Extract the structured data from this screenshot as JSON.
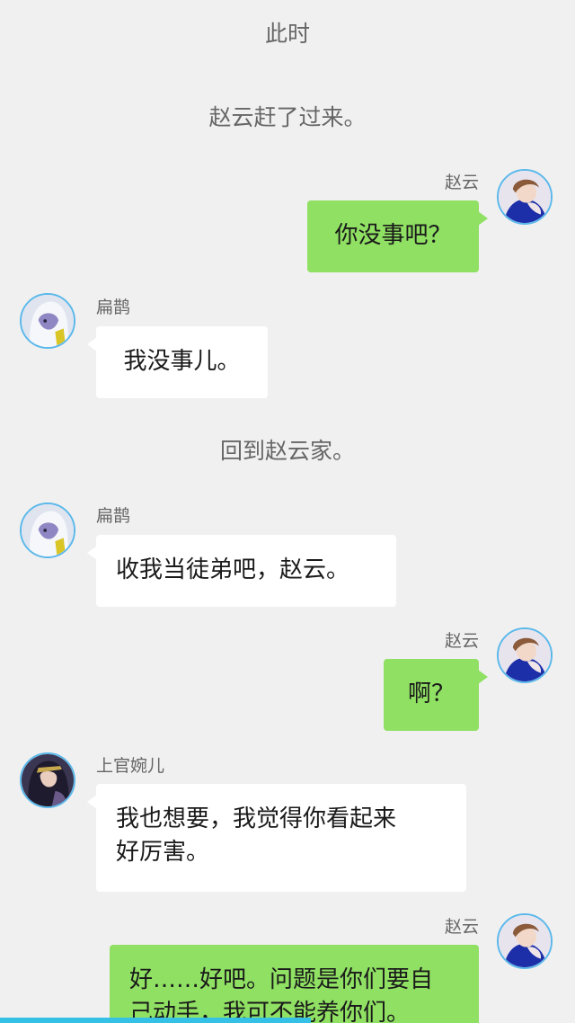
{
  "narration": [
    "此时",
    "赵云赶了过来。",
    "回到赵云家。"
  ],
  "characters": {
    "zhaoyun": {
      "name": "赵云",
      "icon": "zhaoyun-avatar-icon",
      "ring_color": "#5bb8ea"
    },
    "bianque": {
      "name": "扁鹊",
      "icon": "bianque-avatar-icon",
      "ring_color": "#5bb8ea"
    },
    "shangguan": {
      "name": "上官婉儿",
      "icon": "shangguan-wan-er-avatar-icon",
      "ring_color": "#5bb8ea"
    }
  },
  "messages": [
    {
      "speaker": "赵云",
      "text": "你没事吧？",
      "side": "right"
    },
    {
      "speaker": "扁鹊",
      "text": "我没事儿。",
      "side": "left"
    },
    {
      "speaker": "扁鹊",
      "text": "收我当徒弟吧，赵云。",
      "side": "left"
    },
    {
      "speaker": "赵云",
      "text": "啊？",
      "side": "right"
    },
    {
      "speaker": "上官婉儿",
      "text": "我也想要，我觉得你看起来好厉害。",
      "line1": "我也想要，我觉得你看起来",
      "line2": "好厉害。",
      "side": "left"
    },
    {
      "speaker": "赵云",
      "text": "好……好吧。问题是你们要自己动手，我可不能养你们。",
      "line1": "好……好吧。问题是你们要自",
      "line2": "己动手，我可不能养你们。",
      "side": "right"
    }
  ],
  "colors": {
    "background": "#f0f0f0",
    "my_bubble": "#8fe063",
    "their_bubble": "#ffffff",
    "avatar_ring": "#5bb8ea",
    "progress_bar": "#35c0e6"
  },
  "progress": {
    "fraction": 0.54
  }
}
